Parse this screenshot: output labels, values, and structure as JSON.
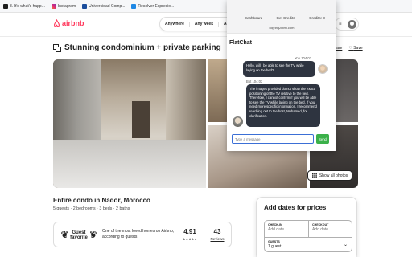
{
  "bookmarks": [
    {
      "label": "8. It's what's happ...",
      "color": "#1d1d1d"
    },
    {
      "label": "Instagram",
      "color": "#e1306c"
    },
    {
      "label": "Universidad Comp...",
      "color": "#1a4d9c"
    },
    {
      "label": "Resolver Expresio...",
      "color": "#1e88e5"
    }
  ],
  "airbnb": {
    "logo_text": "airbnb",
    "brand_color": "#ff385c",
    "search": [
      "Anywhere",
      "Any week",
      "Add"
    ],
    "menu_icon": "≡"
  },
  "listing": {
    "title": "Stunning condominium + private parking",
    "share_label": "Share",
    "save_label": "Save",
    "show_all_photos": "Show all photos",
    "subtitle": "Entire condo in Nador, Morocco",
    "details": "5 guests · 2 bedrooms · 3 beds · 2 baths",
    "guest_favorite_badge": "Guest favorite",
    "guest_favorite_text": "One of the most loved homes on Airbnb, according to guests",
    "rating": "4.91",
    "stars": "★★★★★",
    "reviews_count": "43",
    "reviews_label": "Reviews"
  },
  "booking": {
    "title": "Add dates for prices",
    "checkin_label": "CHECK-IN",
    "checkin_value": "Add date",
    "checkout_label": "CHECKOUT",
    "checkout_value": "Add date",
    "guests_label": "GUESTS",
    "guests_value": "1 guest"
  },
  "flatchat": {
    "nav_dashboard": "Dashboard",
    "nav_get_credits": "Get Credits",
    "credits": "Credits: 3",
    "email": "hi@ing2html.com",
    "title": "FlatChat",
    "user_meta": "You 104:03",
    "user_message": "Hello, will I be able to see the TV while laying on the bed?",
    "bot_meta": "Bot 104:03",
    "bot_message": "The images provided do not show the exact positioning of the TV relative to the bed. Therefore, I cannot confirm if you will be able to see the TV while laying on the bed. If you need more specific information, I recommend reaching out to the host, Mohamed, for clarification.",
    "input_placeholder": "Type a message",
    "send_label": "Send"
  }
}
